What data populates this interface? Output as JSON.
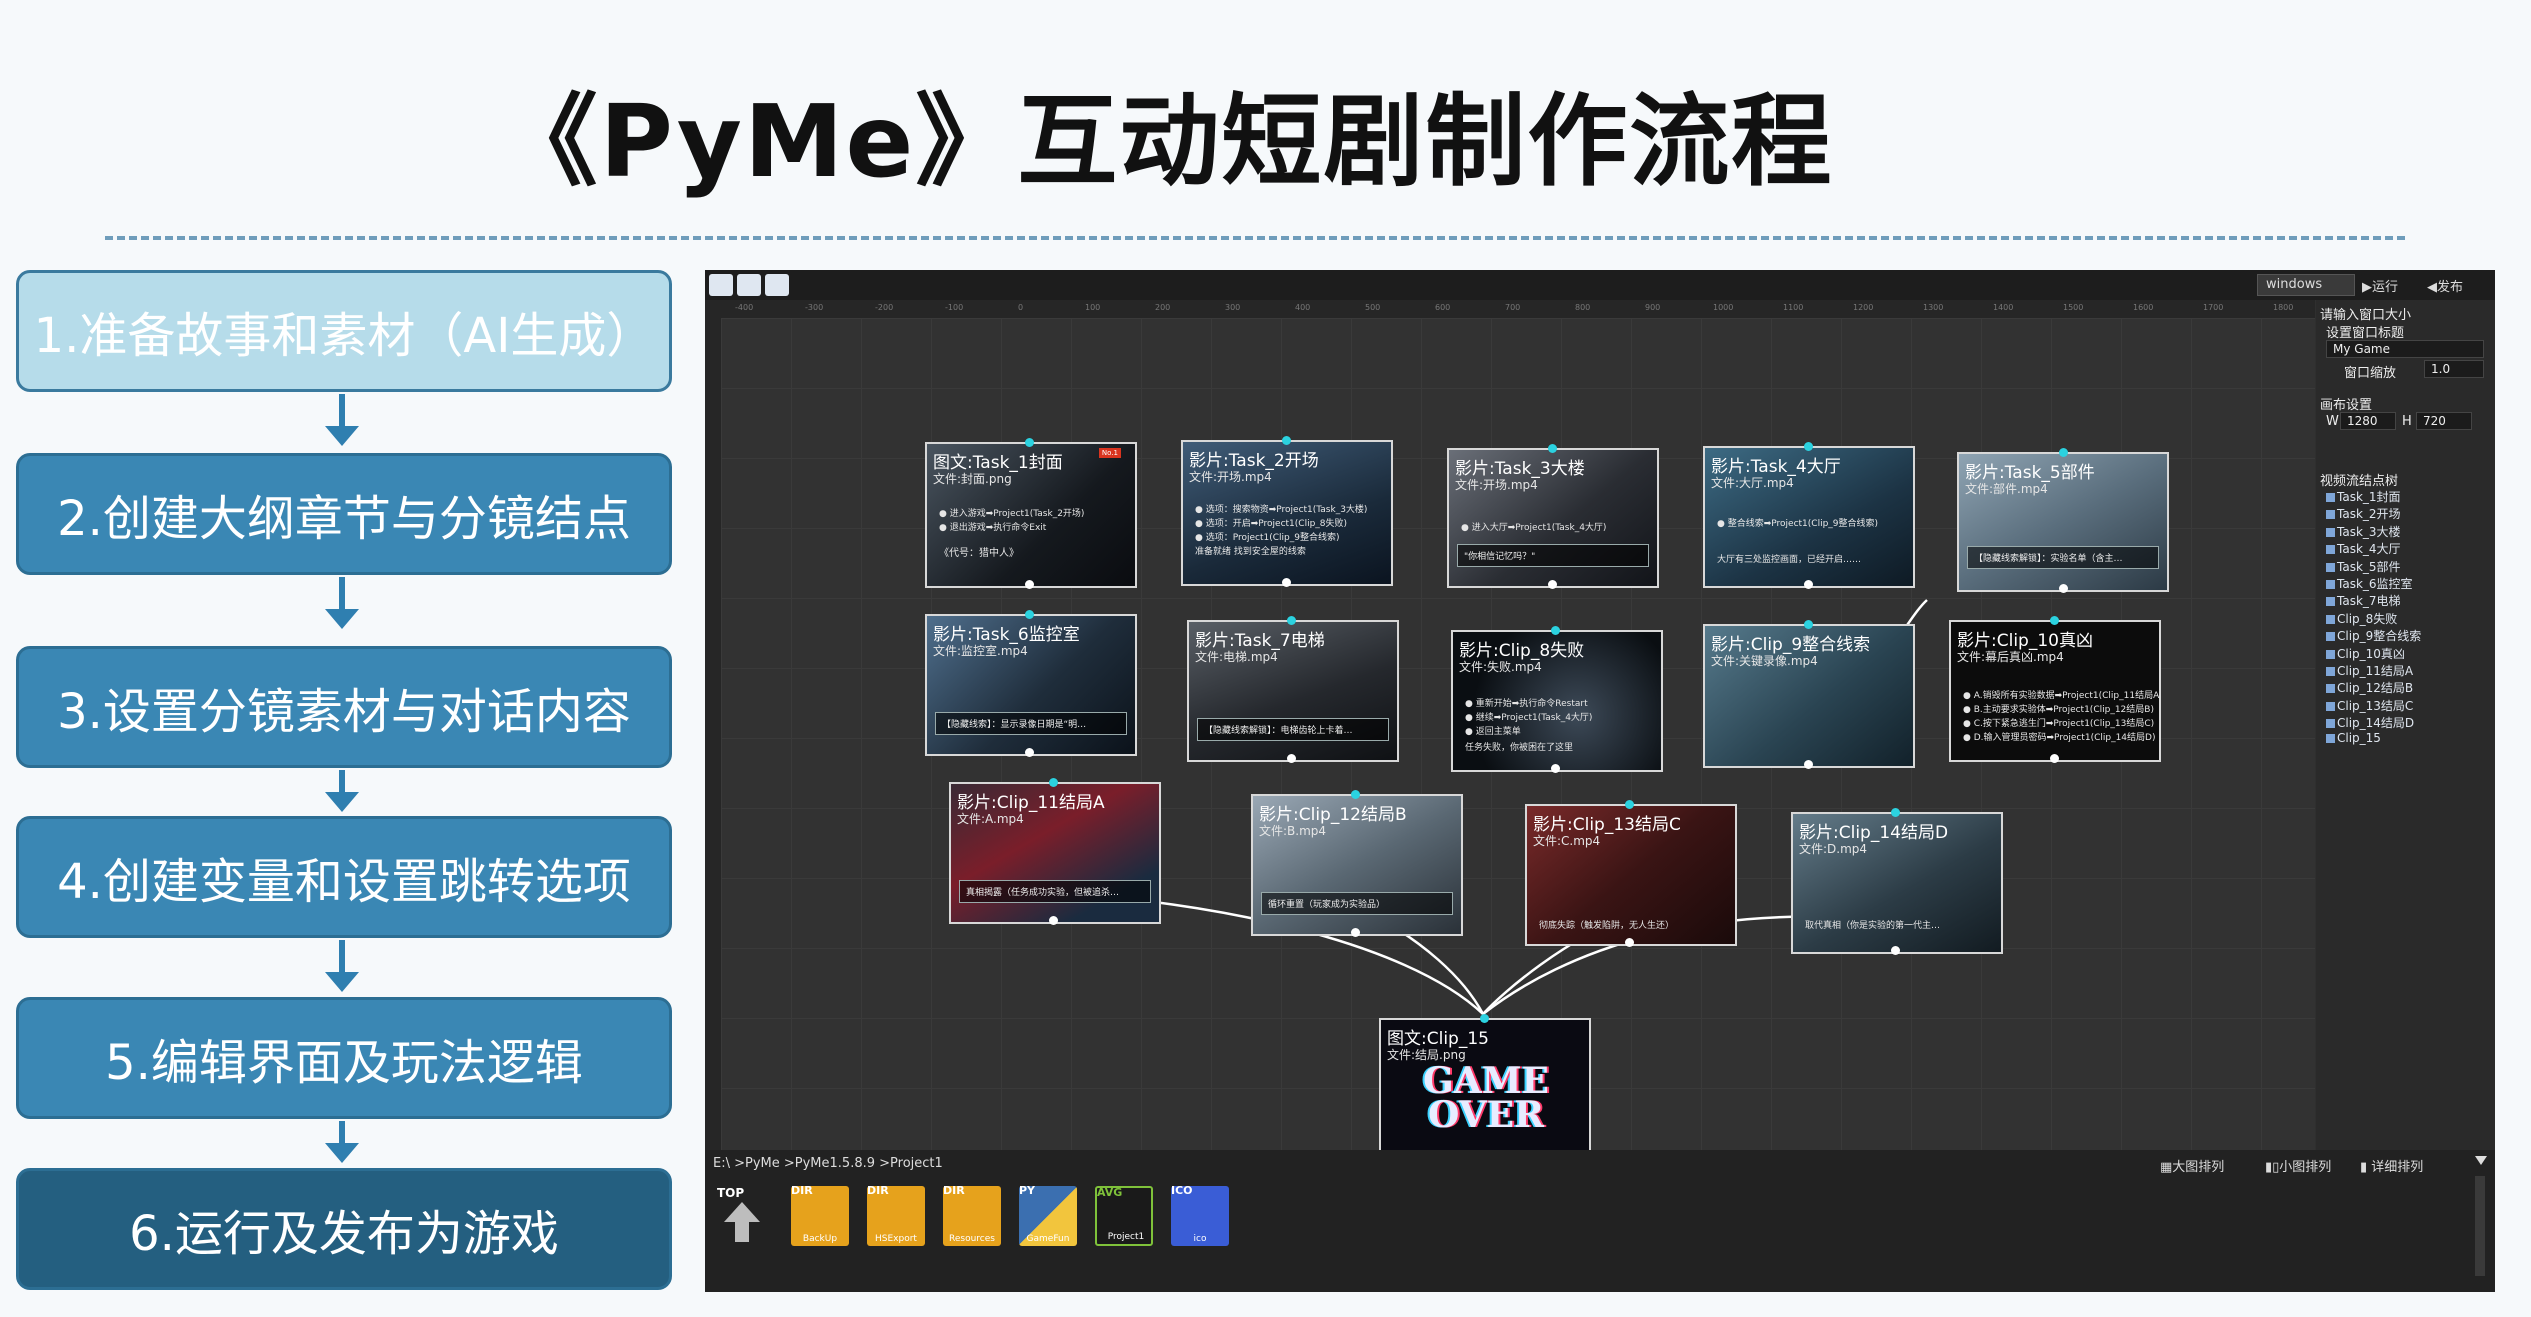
{
  "title": "《PyMe》互动短剧制作流程",
  "steps": [
    {
      "label": "1.准备故事和素材（AI生成）"
    },
    {
      "label": "2.创建大纲章节与分镜结点"
    },
    {
      "label": "3.设置分镜素材与对话内容"
    },
    {
      "label": "4.创建变量和设置跳转选项"
    },
    {
      "label": "5.编辑界面及玩法逻辑"
    },
    {
      "label": "6.运行及发布为游戏"
    }
  ],
  "colors": {
    "step_active": "#b6dcea",
    "step_dark": "#2f7fb0",
    "step_darkest": "#20607f",
    "connector": "#2bd2e0",
    "panel_bg": "#2f2f2f"
  },
  "toolbar": {
    "platform": "windows",
    "run": "▶运行",
    "publish": "◀发布",
    "icons": [
      "edit-icon",
      "grid-icon",
      "doc-edit-icon"
    ]
  },
  "ruler": [
    "-400",
    "-300",
    "-200",
    "-100",
    "0",
    "100",
    "200",
    "300",
    "400",
    "500",
    "600",
    "700",
    "800",
    "900",
    "1000",
    "1100",
    "1200",
    "1300",
    "1400",
    "1500",
    "1600",
    "1700",
    "1800"
  ],
  "nodes": [
    {
      "title": "图文:Task_1封面",
      "file": "文件:封面.png",
      "opts": [
        "● 进入游戏➡Project1(Task_2开场)",
        "● 退出游戏➡执行命令Exit"
      ],
      "box": "《代号：猎中人》",
      "badge": "No.1"
    },
    {
      "title": "影片:Task_2开场",
      "file": "文件:开场.mp4",
      "opts": [
        "● 选项：搜索物资➡Project1(Task_3大楼)",
        "● 选项：开启➡Project1(Clip_8失败)",
        "● 选项：Project1(Clip_9整合线索)"
      ],
      "box": "准备就绪 找到安全屋的线索"
    },
    {
      "title": "影片:Task_3大楼",
      "file": "文件:开场.mp4",
      "opts": [
        "● 进入大厅➡Project1(Task_4大厅)"
      ],
      "box": "\"你相信记忆吗？\""
    },
    {
      "title": "影片:Task_4大厅",
      "file": "文件:大厅.mp4",
      "opts": [
        "● 整合线索➡Project1(Clip_9整合线索)"
      ],
      "box": "大厅有三处监控画面，已经开启……"
    },
    {
      "title": "影片:Task_5部件",
      "file": "文件:部件.mp4",
      "opts": [],
      "box": "【隐藏线索解锁】：实验名单（含主…"
    },
    {
      "title": "影片:Task_6监控室",
      "file": "文件:监控室.mp4",
      "opts": [],
      "box": "【隐藏线索】：显示录像日期是“明…"
    },
    {
      "title": "影片:Task_7电梯",
      "file": "文件:电梯.mp4",
      "opts": [],
      "box": "【隐藏线索解锁】：电梯齿轮上卡着…"
    },
    {
      "title": "影片:Clip_8失败",
      "file": "文件:失败.mp4",
      "opts": [
        "● 重新开始➡执行命令Restart",
        "● 继续➡Project1(Task_4大厅)",
        "● 返回主菜单"
      ],
      "box": "任务失败，你被困在了这里"
    },
    {
      "title": "影片:Clip_9整合线索",
      "file": "文件:关键录像.mp4",
      "opts": [],
      "box": ""
    },
    {
      "title": "影片:Clip_10真凶",
      "file": "文件:幕后真凶.mp4",
      "opts": [
        "● A.销毁所有实验数据➡Project1(Clip_11结局A)",
        "● B.主动要求实验体➡Project1(Clip_12结局B)",
        "● C.按下紧急逃生门➡Project1(Clip_13结局C)",
        "● D.输入管理员密码➡Project1(Clip_14结局D)"
      ],
      "box": ""
    },
    {
      "title": "影片:Clip_11结局A",
      "file": "文件:A.mp4",
      "opts": [],
      "box": "真相揭露（任务成功实验，但被追杀…"
    },
    {
      "title": "影片:Clip_12结局B",
      "file": "文件:B.mp4",
      "opts": [],
      "box": "循环重置（玩家成为实验品）"
    },
    {
      "title": "影片:Clip_13结局C",
      "file": "文件:C.mp4",
      "opts": [],
      "box": "彻底失踪（触发陷阱，无人生还）"
    },
    {
      "title": "影片:Clip_14结局D",
      "file": "文件:D.mp4",
      "opts": [],
      "box": "取代真相（你是实验的第一代主…"
    },
    {
      "title": "图文:Clip_15",
      "file": "文件:结局.png",
      "opts": [],
      "box": "",
      "big": "GAME OVER"
    }
  ],
  "properties": {
    "window_label": "请输入窗口大小",
    "window_title_label": "设置窗口标题",
    "window_title_value": "My Game",
    "zoom_label": "窗口缩放",
    "zoom_value": "1.0",
    "canvas_label": "画布设置",
    "w_label": "W",
    "w_value": "1280",
    "h_label": "H",
    "h_value": "720",
    "tree_label": "视频流结点树",
    "tree": [
      "Task_1封面",
      "Task_2开场",
      "Task_3大楼",
      "Task_4大厅",
      "Task_5部件",
      "Task_6监控室",
      "Task_7电梯",
      "Clip_8失败",
      "Clip_9整合线索",
      "Clip_10真凶",
      "Clip_11结局A",
      "Clip_12结局B",
      "Clip_13结局C",
      "Clip_14结局D",
      "Clip_15"
    ]
  },
  "browser": {
    "path": "E:\\ >PyMe >PyMe1.5.8.9 >Project1",
    "view_large": "▦大图排列",
    "view_small": "▮▯小图排列",
    "view_detail": "▮ 详细排列",
    "top_label": "TOP",
    "files": [
      {
        "tag": "DIR",
        "name": "BackUp",
        "color": "#e6a21c"
      },
      {
        "tag": "DIR",
        "name": "HSExport",
        "color": "#e6a21c"
      },
      {
        "tag": "DIR",
        "name": "Resources",
        "color": "#e6a21c"
      },
      {
        "tag": "PY",
        "name": "GameFun",
        "color": "#f2c53d"
      },
      {
        "tag": "AVG",
        "name": "Project1",
        "color": "#1a1a1a"
      },
      {
        "tag": "ICO",
        "name": "ico",
        "color": "#3a5dd6"
      }
    ]
  }
}
